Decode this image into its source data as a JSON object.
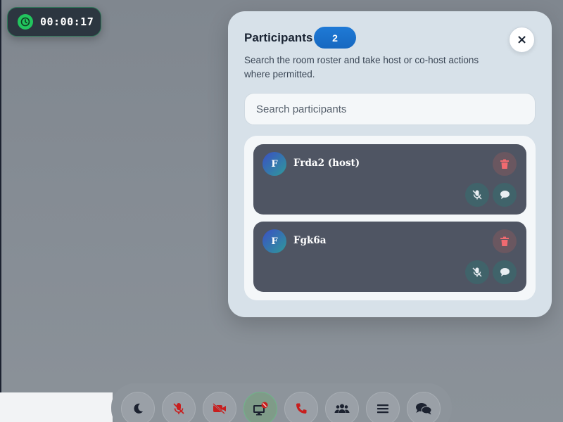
{
  "timer": {
    "elapsed": "00:00:17",
    "icon": "clock-icon"
  },
  "panel": {
    "title": "Participants",
    "count": "2",
    "close_label": "×",
    "description": "Search the room roster and take host or co-host actions where permitted.",
    "search": {
      "placeholder": "Search participants",
      "value": ""
    }
  },
  "participants": [
    {
      "initial": "F",
      "name": "Frda2 (host)",
      "actions": [
        "delete-icon",
        "mic-off-icon",
        "chat-icon"
      ]
    },
    {
      "initial": "F",
      "name": "Fgk6a",
      "actions": [
        "delete-icon",
        "mic-off-icon",
        "chat-icon"
      ]
    }
  ],
  "toolbar": {
    "buttons": [
      "moon-icon",
      "mic-off-icon",
      "video-off-icon",
      "screen-share-off-icon",
      "phone-icon",
      "people-icon",
      "menu-icon",
      "chat-icon"
    ]
  },
  "colors": {
    "accent": "#1f7ad6",
    "danger": "#e5484d",
    "success": "#22c55e",
    "card_bg": "#4f5563",
    "panel_bg": "#d7e1e9"
  }
}
